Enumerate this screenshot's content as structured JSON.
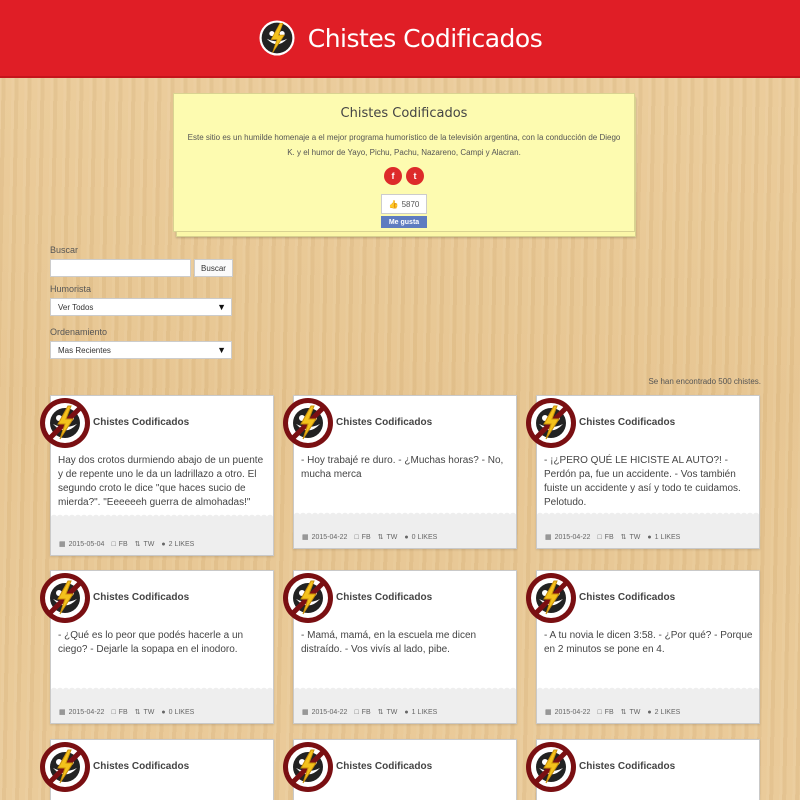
{
  "header": {
    "title": "Chistes Codificados"
  },
  "about": {
    "title": "Chistes Codificados",
    "description": "Este sitio es un humilde homenaje a el mejor programa humorístico de la televisión argentina, con la conducción de Diego K. y el humor de Yayo, Pichu, Pachu, Nazareno, Campi y Alacran.",
    "social": [
      "f",
      "t"
    ],
    "like_count": "5870",
    "like_button": "Me gusta"
  },
  "filters": {
    "search_label": "Buscar",
    "search_value": "",
    "search_button": "Buscar",
    "humorist_label": "Humorista",
    "humorist_value": "Ver Todos",
    "order_label": "Ordenamiento",
    "order_value": "Mas Recientes"
  },
  "results_count": "Se han encontrado 500 chistes.",
  "cards": [
    {
      "author": "Chistes Codificados",
      "text": "Hay dos crotos durmiendo abajo de un puente y de repente uno le da un ladrillazo a otro. El segundo croto le dice \"que haces sucio de mierda?\". \"Eeeeeeh guerra de almohadas!\"",
      "date": "2015-05-04",
      "fb": "FB",
      "tw": "TW",
      "likes": "2 LIKES"
    },
    {
      "author": "Chistes Codificados",
      "text": "- Hoy trabajé re duro. - ¿Muchas horas? - No, mucha merca",
      "date": "2015-04-22",
      "fb": "FB",
      "tw": "TW",
      "likes": "0 LIKES"
    },
    {
      "author": "Chistes Codificados",
      "text": "- ¡¿PERO QUÉ LE HICISTE AL AUTO?! - Perdón pa, fue un accidente. - Vos también fuiste un accidente y así y todo te cuidamos. Pelotudo.",
      "date": "2015-04-22",
      "fb": "FB",
      "tw": "TW",
      "likes": "1 LIKES"
    },
    {
      "author": "Chistes Codificados",
      "text": "- ¿Qué es lo peor que podés hacerle a un ciego? - Dejarle la sopapa en el inodoro.",
      "date": "2015-04-22",
      "fb": "FB",
      "tw": "TW",
      "likes": "0 LIKES"
    },
    {
      "author": "Chistes Codificados",
      "text": "- Mamá, mamá, en la escuela me dicen distraído. - Vos vivís al lado, pibe.",
      "date": "2015-04-22",
      "fb": "FB",
      "tw": "TW",
      "likes": "1 LIKES"
    },
    {
      "author": "Chistes Codificados",
      "text": "- A tu novia le dicen 3:58. - ¿Por qué? - Porque en 2 minutos se pone en 4.",
      "date": "2015-04-22",
      "fb": "FB",
      "tw": "TW",
      "likes": "2 LIKES"
    },
    {
      "author": "Chistes Codificados"
    },
    {
      "author": "Chistes Codificados"
    },
    {
      "author": "Chistes Codificados"
    }
  ],
  "colors": {
    "header": "#e01e26",
    "note": "#fdfbb0",
    "wood": "#e8c690"
  }
}
